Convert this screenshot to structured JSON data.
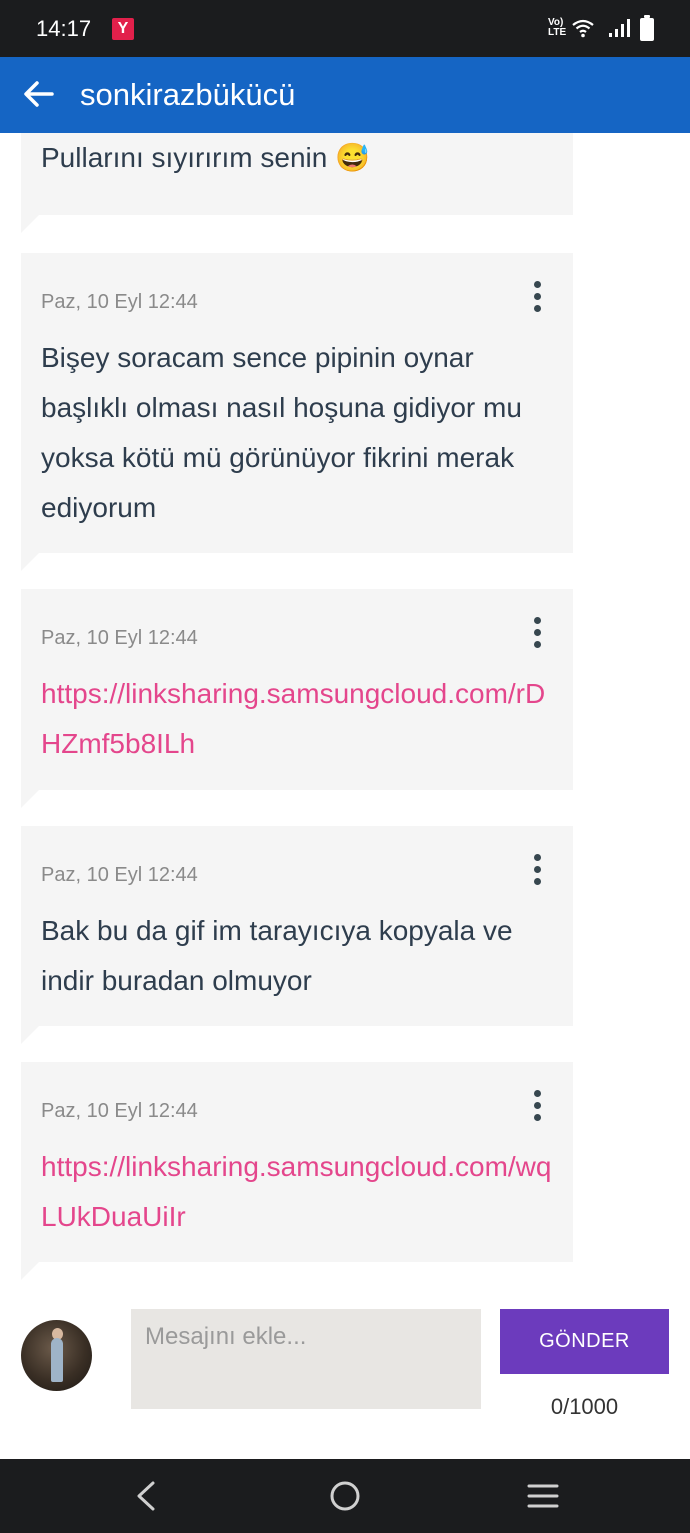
{
  "status_bar": {
    "time": "14:17",
    "app_badge": "Y",
    "network": "Vo) LTE",
    "icons": [
      "volte-lte-icon",
      "wifi-icon",
      "signal-icon",
      "battery-icon"
    ]
  },
  "header": {
    "title": "sonkirazbükücü",
    "back_icon": "arrow-left-icon",
    "color": "#1565c4"
  },
  "messages": [
    {
      "time": "",
      "text": "Pullarını sıyırırım senin 😅",
      "is_link": false
    },
    {
      "time": "Paz, 10 Eyl 12:44",
      "text": "Bişey soracam sence pipinin oynar başlıklı olması nasıl hoşuna gidiyor mu yoksa kötü mü görünüyor fikrini merak ediyorum",
      "is_link": false
    },
    {
      "time": "Paz, 10 Eyl 12:44",
      "text": "https://linksharing.samsungcloud.com/rDHZmf5b8ILh",
      "is_link": true
    },
    {
      "time": "Paz, 10 Eyl 12:44",
      "text": "Bak bu da gif im tarayıcıya kopyala ve indir buradan olmuyor",
      "is_link": false
    },
    {
      "time": "Paz, 10 Eyl 12:44",
      "text": "https://linksharing.samsungcloud.com/wqLUkDuaUiIr",
      "is_link": true
    }
  ],
  "composer": {
    "placeholder": "Mesajını ekle...",
    "value": "",
    "send_label": "GÖNDER",
    "char_count": "0/1000",
    "send_color": "#6c3bbd"
  },
  "nav_bar": {
    "icons": [
      "back-nav-icon",
      "home-nav-icon",
      "recents-nav-icon"
    ]
  },
  "colors": {
    "link": "#e4468c",
    "bubble": "#f5f5f5",
    "text": "#2e3d4d"
  }
}
